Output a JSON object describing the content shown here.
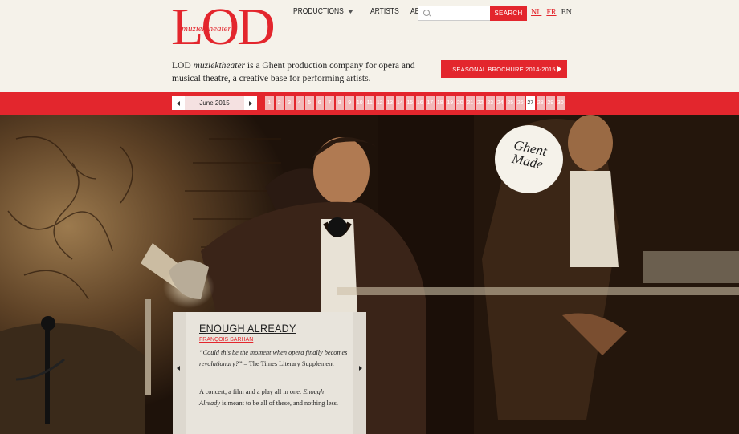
{
  "logo": {
    "main": "LOD",
    "sub": "muziektheater"
  },
  "nav": {
    "productions": "PRODUCTIONS",
    "artists": "ARTISTS",
    "about": "ABOUT US"
  },
  "search": {
    "placeholder": "",
    "button": "SEARCH"
  },
  "languages": {
    "nl": "NL",
    "fr": "FR",
    "en": "EN"
  },
  "tagline": {
    "brand": "LOD",
    "brand_italic": "muziektheater",
    "rest": " is a Ghent production company for opera and musical theatre, a creative base for performing artists."
  },
  "brochure_button": "SEASONAL BROCHURE 2014-2015",
  "calendar": {
    "month": "June 2015",
    "days": [
      "1",
      "2",
      "3",
      "4",
      "5",
      "6",
      "7",
      "8",
      "9",
      "10",
      "11",
      "12",
      "13",
      "14",
      "15",
      "16",
      "17",
      "18",
      "19",
      "20",
      "21",
      "22",
      "23",
      "24",
      "25",
      "26",
      "27",
      "28",
      "29",
      "30"
    ],
    "highlight_day": "27"
  },
  "badge": {
    "line1": "Ghent",
    "line2": "Made"
  },
  "feature": {
    "title": "ENOUGH ALREADY",
    "author": "FRANÇOIS SARHAN",
    "quote": "“Could this be the moment when opera finally becomes revolutionary?”",
    "quote_source": " – The Times Literary Supplement",
    "desc_a": "A concert, a film and a play all in one: ",
    "desc_italic": "Enough Already",
    "desc_b": " is meant to be all of these, and nothing less."
  },
  "colors": {
    "accent": "#e3262d",
    "background": "#f5f2ea"
  }
}
